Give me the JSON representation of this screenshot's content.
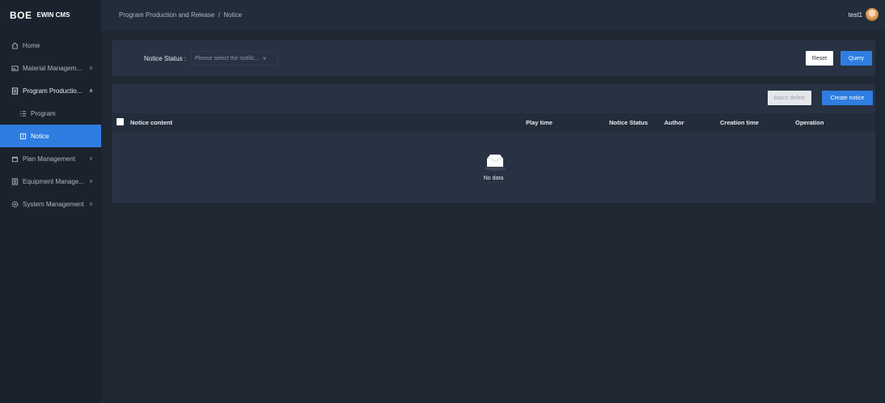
{
  "app": {
    "brand": "BOE",
    "product": "EWIN CMS"
  },
  "sidebar": {
    "items": [
      {
        "label": "Home",
        "icon": "home-icon"
      },
      {
        "label": "Material Managem...",
        "icon": "image-icon",
        "chevron": "∨"
      },
      {
        "label": "Program Productio...",
        "icon": "file-icon",
        "chevron": "∧"
      },
      {
        "label": "Program",
        "icon": "list-icon"
      },
      {
        "label": "Notice",
        "icon": "notice-icon"
      },
      {
        "label": "Plan Management",
        "icon": "calendar-icon",
        "chevron": "∨"
      },
      {
        "label": "Equipment Manage...",
        "icon": "device-icon",
        "chevron": "∨"
      },
      {
        "label": "System Management",
        "icon": "settings-icon",
        "chevron": "∨"
      }
    ]
  },
  "header": {
    "breadcrumb": "Program Production and Release  /  Notice",
    "username": "test1"
  },
  "filter": {
    "label": "Notice Status :",
    "select_placeholder": "Please select the notific...",
    "reset_label": "Reset",
    "query_label": "Query"
  },
  "toolbar": {
    "batch_delete_label": "Batch delete",
    "create_label": "Create notice"
  },
  "table": {
    "columns": [
      "Notice content",
      "Play time",
      "Notice Status",
      "Author",
      "Creation time",
      "Operation"
    ],
    "empty_text": "No data"
  },
  "colors": {
    "accent": "#2f7de1",
    "sidebar_bg": "#1a222d",
    "panel_bg": "#283242",
    "page_bg": "#1f2733"
  }
}
